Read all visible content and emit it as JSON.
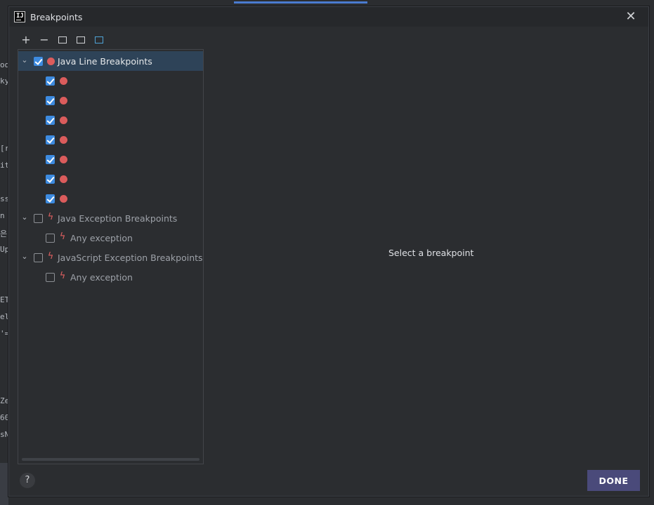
{
  "dialog": {
    "title": "Breakpoints",
    "close_glyph": "✕",
    "detail_message": "Select a breakpoint",
    "help_glyph": "?",
    "done_label": "DONE"
  },
  "toolbar": {
    "add_glyph": "+",
    "remove_glyph": "−"
  },
  "tree": {
    "groups": [
      {
        "label": "Java Line Breakpoints",
        "checked": true,
        "expanded": true,
        "icon": "breakpoint-dot-icon",
        "child_count": 7
      },
      {
        "label": "Java Exception Breakpoints",
        "checked": false,
        "expanded": true,
        "icon": "lightning-icon",
        "children": [
          {
            "label": "Any exception",
            "checked": false
          }
        ]
      },
      {
        "label": "JavaScript Exception Breakpoints",
        "checked": false,
        "expanded": true,
        "icon": "lightning-icon",
        "children": [
          {
            "label": "Any exception",
            "checked": false
          }
        ]
      }
    ]
  },
  "colors": {
    "accent": "#3d8be0",
    "breakpoint_red": "#db5c5c",
    "selection": "#2e4358",
    "done_button": "#4a4a7a"
  },
  "background_editor": {
    "left_fragments": [
      "od",
      "ky",
      "[r",
      "it",
      "ss",
      "n",
      "은",
      "Up",
      "ET",
      "el",
      "'=",
      "Ze",
      "60",
      "sN"
    ]
  }
}
